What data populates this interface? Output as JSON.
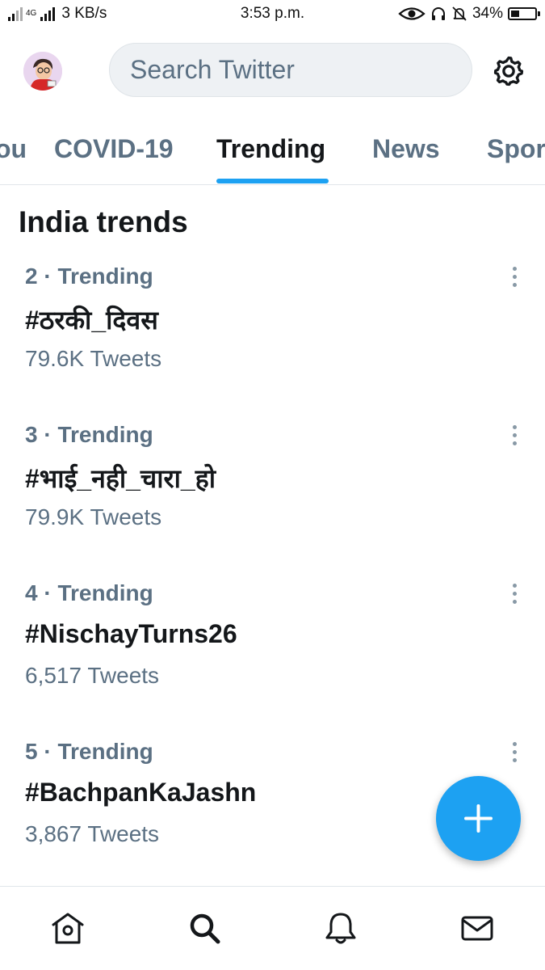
{
  "status_bar": {
    "network_label": "4G",
    "speed": "3 KB/s",
    "time": "3:53 p.m.",
    "battery_percent": "34%",
    "battery_level": 0.34,
    "icons": [
      "signal-icon",
      "eye-icon",
      "headphones-icon",
      "bell-muted-icon",
      "battery-icon"
    ]
  },
  "header": {
    "search_placeholder": "Search Twitter",
    "avatar_icon": "avatar",
    "settings_icon": "gear-icon"
  },
  "tabs": [
    {
      "label": "ou",
      "active": false
    },
    {
      "label": "COVID-19",
      "active": false
    },
    {
      "label": "Trending",
      "active": true
    },
    {
      "label": "News",
      "active": false
    },
    {
      "label": "Spor",
      "active": false
    }
  ],
  "section_title": "India trends",
  "trends": [
    {
      "meta": "2 · Trending",
      "tag": "#ठरकी_दिवस",
      "count": "79.6K Tweets"
    },
    {
      "meta": "3 · Trending",
      "tag": "#भाई_नही_चारा_हो",
      "count": "79.9K Tweets"
    },
    {
      "meta": "4 · Trending",
      "tag": "#NischayTurns26",
      "count": "6,517 Tweets"
    },
    {
      "meta": "5 · Trending",
      "tag": "#BachpanKaJashn",
      "count": "3,867 Tweets"
    }
  ],
  "bottom_nav": [
    "home-icon",
    "search-icon",
    "notifications-icon",
    "messages-icon"
  ],
  "colors": {
    "accent": "#1da1f2",
    "secondary_text": "#5b7083",
    "primary_text": "#14171a"
  }
}
